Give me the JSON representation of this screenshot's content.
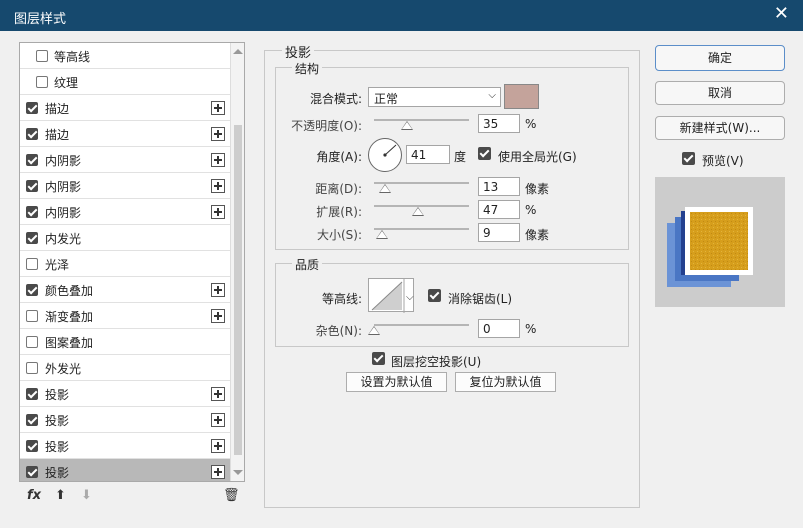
{
  "window": {
    "title": "图层样式"
  },
  "fx_list": [
    {
      "label": "等高线",
      "checked": false,
      "has_plus": false
    },
    {
      "label": "纹理",
      "checked": false,
      "has_plus": false
    },
    {
      "label": "描边",
      "checked": true,
      "has_plus": true
    },
    {
      "label": "描边",
      "checked": true,
      "has_plus": true
    },
    {
      "label": "内阴影",
      "checked": true,
      "has_plus": true
    },
    {
      "label": "内阴影",
      "checked": true,
      "has_plus": true
    },
    {
      "label": "内阴影",
      "checked": true,
      "has_plus": true
    },
    {
      "label": "内发光",
      "checked": true,
      "has_plus": false
    },
    {
      "label": "光泽",
      "checked": false,
      "has_plus": false
    },
    {
      "label": "颜色叠加",
      "checked": true,
      "has_plus": true
    },
    {
      "label": "渐变叠加",
      "checked": false,
      "has_plus": true
    },
    {
      "label": "图案叠加",
      "checked": false,
      "has_plus": false
    },
    {
      "label": "外发光",
      "checked": false,
      "has_plus": false
    },
    {
      "label": "投影",
      "checked": true,
      "has_plus": true
    },
    {
      "label": "投影",
      "checked": true,
      "has_plus": true
    },
    {
      "label": "投影",
      "checked": true,
      "has_plus": true
    },
    {
      "label": "投影",
      "checked": true,
      "has_plus": true,
      "selected": true
    }
  ],
  "bottom_tools": {
    "fx": "fx",
    "up": "⬆",
    "down": "⬇",
    "trash": "🗑"
  },
  "shadow": {
    "section_title": "投影",
    "structure": {
      "title": "结构",
      "blend_mode_label": "混合模式:",
      "blend_mode_value": "正常",
      "color": "#c4a39b",
      "opacity_label": "不透明度(O):",
      "opacity_value": "35",
      "opacity_unit": "%",
      "angle_label": "角度(A):",
      "angle_value": "41",
      "angle_unit": "度",
      "global_light_label": "使用全局光(G)",
      "distance_label": "距离(D):",
      "distance_value": "13",
      "distance_unit": "像素",
      "spread_label": "扩展(R):",
      "spread_value": "47",
      "spread_unit": "%",
      "size_label": "大小(S):",
      "size_value": "9",
      "size_unit": "像素"
    },
    "quality": {
      "title": "品质",
      "contour_label": "等高线:",
      "antialias_label": "消除锯齿(L)",
      "noise_label": "杂色(N):",
      "noise_value": "0",
      "noise_unit": "%"
    },
    "knockout_label": "图层挖空投影(U)",
    "set_default_label": "设置为默认值",
    "reset_default_label": "复位为默认值"
  },
  "buttons": {
    "ok": "确定",
    "cancel": "取消",
    "new_style": "新建样式(W)...",
    "preview_label": "预览(V)"
  }
}
